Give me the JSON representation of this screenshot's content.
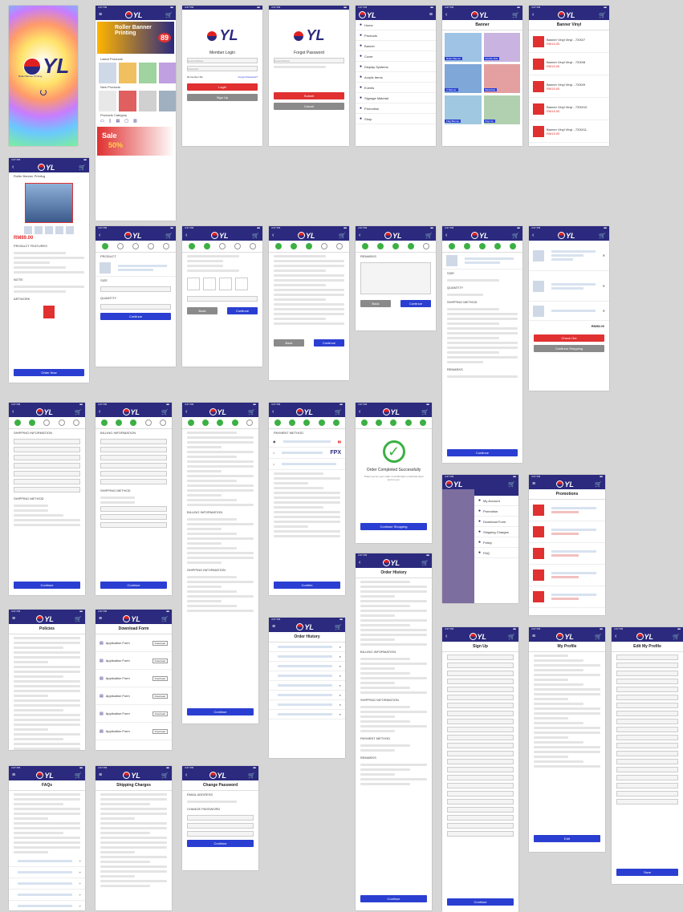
{
  "status_time": "4:37 PM",
  "brand": {
    "logo_text": "YL"
  },
  "splash": {
    "tagline": "Roller Banner Printing"
  },
  "home": {
    "banner_title": "Roller Banner Printing",
    "banner_price": "89",
    "sale_text": "Sale",
    "sale_pct": "50%",
    "sections": [
      "Latest Products",
      "New Products",
      "Products Category"
    ]
  },
  "login": {
    "title": "Member Login",
    "email_placeholder": "Email Address",
    "password_placeholder": "Password",
    "remember": "Remember Me",
    "forgot": "Forgot Password?",
    "login_btn": "Login",
    "signup_btn": "Sign Up"
  },
  "forgot": {
    "title": "Forgot Password",
    "email_placeholder": "Email Address",
    "submit_btn": "Submit",
    "cancel_btn": "Cancel"
  },
  "menu": {
    "items": [
      "Home",
      "Products",
      "Banner",
      "Cover",
      "Display Systems",
      "Acrylic Items",
      "Events",
      "Signage Material",
      "Promotion",
      "Shop"
    ]
  },
  "banner": {
    "title": "Banner",
    "tiles": [
      "Roller Banner",
      "Double Roll",
      "X Banner",
      "Backdrop",
      "Flag Banner",
      "Pop Up"
    ]
  },
  "products": {
    "title": "Banner Vinyl",
    "items": [
      {
        "name": "Banner Vinyl Vinyl - 7200/7",
        "price": "RM15.00"
      },
      {
        "name": "Banner Vinyl Vinyl - 7200/8",
        "price": "RM15.00"
      },
      {
        "name": "Banner Vinyl Vinyl - 7200/9",
        "price": "RM15.00"
      },
      {
        "name": "Banner Vinyl Vinyl - 7200/10",
        "price": "RM15.00"
      },
      {
        "name": "Banner Vinyl Vinyl - 7200/11",
        "price": "RM15.00"
      }
    ]
  },
  "detail": {
    "title": "Roller Banner Printing",
    "price": "RM89.00",
    "section_specs": "PRODUCT FEATURES",
    "section_note": "NOTE:",
    "section_artwork": "ARTWORK",
    "order_btn": "Order Now"
  },
  "flow": {
    "continue": "Continue",
    "back": "Back",
    "step_products": "PRODUCT",
    "step_size": "SIZE",
    "step_qty": "QUANTITY",
    "cart_total": "RM98.00",
    "checkout": "Check Out",
    "shopping": "Continue Shopping",
    "shipping_title": "SHIPPING INFORMATION",
    "billing_title": "BILLING INFORMATION",
    "shipping_method": "SHIPPING METHOD",
    "payment_title": "PAYMENT METHOD",
    "remarks": "REMARKS",
    "fpx": "FPX",
    "confirm": "Confirm"
  },
  "success": {
    "title": "Order Completed Successfully",
    "message": "Thank you for your order. A confirmation email has been sent to you.",
    "btn": "Continue Shopping"
  },
  "sidemenu": {
    "items": [
      "My Account",
      "Promotion",
      "Download Form",
      "Shipping Charges",
      "Policy",
      "FAQ"
    ]
  },
  "promotions": {
    "title": "Promotions"
  },
  "policy": {
    "title": "Policies"
  },
  "download": {
    "title": "Download Form",
    "rows": [
      "Application Form",
      "Application Form",
      "Application Form",
      "Application Form",
      "Application Form",
      "Application Form"
    ],
    "btn": "Download"
  },
  "history": {
    "title": "Order History"
  },
  "signup": {
    "title": "Sign Up",
    "btn": "Continue"
  },
  "profile": {
    "title": "My Profile",
    "edit_btn": "Edit"
  },
  "editprofile": {
    "title": "Edit My Profile",
    "save_btn": "Save"
  },
  "faq": {
    "title": "FAQs"
  },
  "shipping": {
    "title": "Shipping Charges"
  },
  "changepw": {
    "title": "Change Password",
    "section_email": "EMAIL ADDRESS",
    "section_pw": "CHANGE PASSWORD",
    "btn": "Continue"
  }
}
